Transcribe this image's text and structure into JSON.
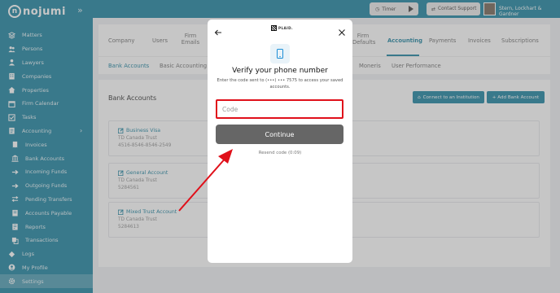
{
  "app": {
    "logo_text": "nojumi",
    "logo_mark": "n",
    "collapse_icon": "»"
  },
  "sidebar": {
    "items": [
      {
        "label": "Matters",
        "icon": "layers-icon"
      },
      {
        "label": "Persons",
        "icon": "users-icon"
      },
      {
        "label": "Lawyers",
        "icon": "user-icon"
      },
      {
        "label": "Companies",
        "icon": "building-icon"
      },
      {
        "label": "Properties",
        "icon": "house-icon"
      },
      {
        "label": "Firm Calendar",
        "icon": "calendar-icon"
      },
      {
        "label": "Tasks",
        "icon": "check-icon"
      },
      {
        "label": "Accounting",
        "icon": "ledger-icon",
        "caret": "›"
      },
      {
        "label": "Invoices",
        "icon": "invoice-icon"
      },
      {
        "label": "Bank Accounts",
        "icon": "bank-icon"
      },
      {
        "label": "Incoming Funds",
        "icon": "arrow-right-icon"
      },
      {
        "label": "Outgoing Funds",
        "icon": "arrow-right-icon"
      },
      {
        "label": "Pending Transfers",
        "icon": "transfer-icon"
      },
      {
        "label": "Accounts Payable",
        "icon": "payable-icon"
      },
      {
        "label": "Reports",
        "icon": "report-icon"
      },
      {
        "label": "Transactions",
        "icon": "transactions-icon"
      },
      {
        "label": "Logs",
        "icon": "logs-icon"
      },
      {
        "label": "My Profile",
        "icon": "profile-icon"
      },
      {
        "label": "Settings",
        "icon": "gear-icon"
      }
    ]
  },
  "topbar": {
    "timer_label": "Timer",
    "support_label": "Contact Support",
    "user_name": "Stern, Lockhart & Gardner"
  },
  "tabs": {
    "company": "Company",
    "users": "Users",
    "firm_emails_1": "Firm",
    "firm_emails_2": "Emails",
    "firm_defaults_1": "Firm",
    "firm_defaults_2": "Defaults",
    "accounting": "Accounting",
    "payments": "Payments",
    "invoices": "Invoices",
    "subscriptions": "Subscriptions"
  },
  "subtabs": {
    "bank_accounts": "Bank Accounts",
    "basic_accounting": "Basic Accounting S",
    "moneris": "Moneris",
    "user_performance": "User Performance"
  },
  "panel": {
    "title": "Bank Accounts",
    "connect_label": "Connect to an Institution",
    "add_label": "+ Add Bank Account"
  },
  "accounts": [
    {
      "name": "Business Visa",
      "bank": "TD Canada Trust",
      "number": "4516-8546-8546-2549"
    },
    {
      "name": "General Account",
      "bank": "TD Canada Trust",
      "number": "5284561"
    },
    {
      "name": "Mixed Trust Account",
      "bank": "TD Canada Trust",
      "number": "5284613"
    }
  ],
  "modal": {
    "brand": "PLAID.",
    "title": "Verify your phone number",
    "description": "Enter the code sent to (•••) ••• 7575 to access your saved accounts.",
    "code_placeholder": "Code",
    "continue_label": "Continue",
    "resend_label": "Resend code (0:09)"
  },
  "colors": {
    "brand": "#0d7a99",
    "highlight": "#e0101a",
    "button_gray": "#666666"
  }
}
